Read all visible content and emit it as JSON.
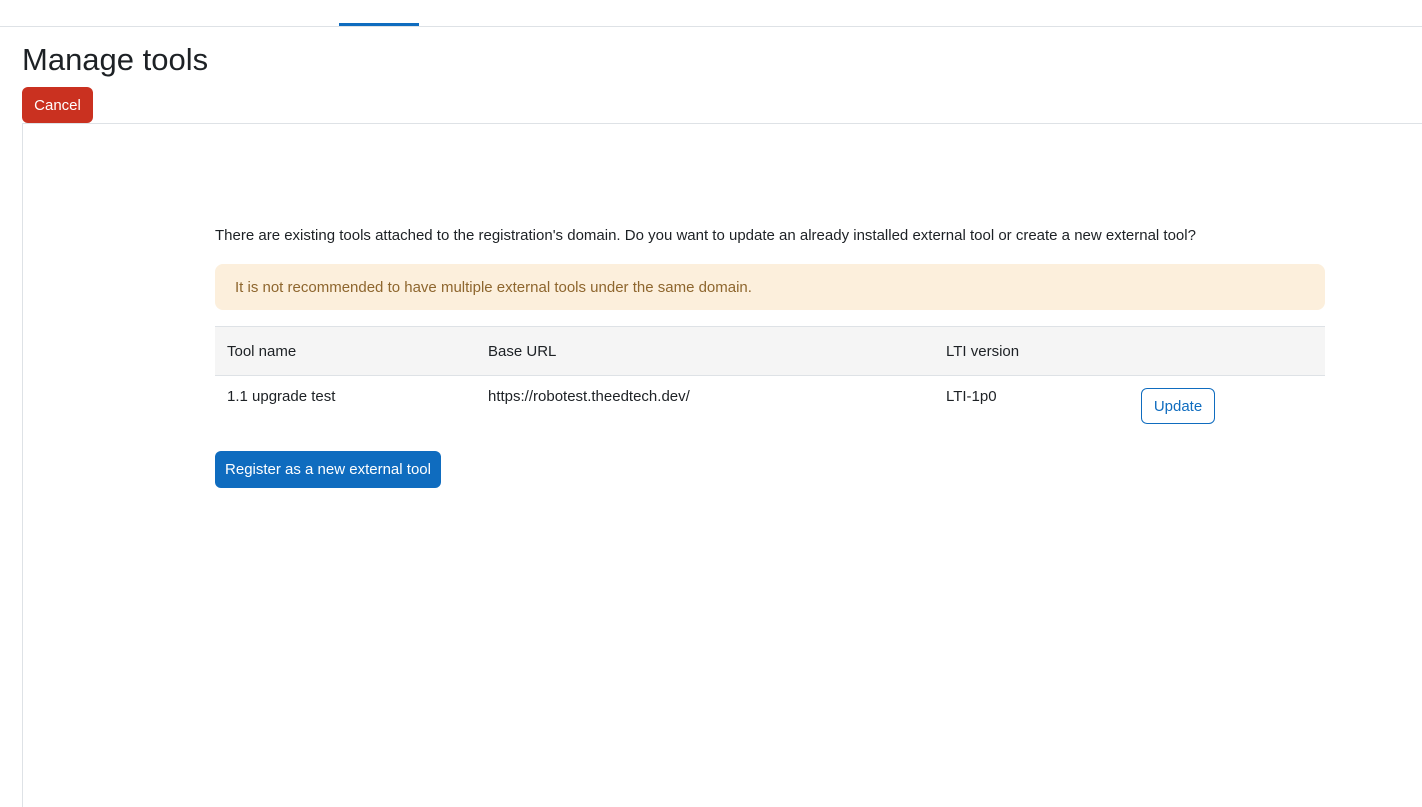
{
  "page": {
    "title": "Manage tools"
  },
  "actions": {
    "cancel_label": "Cancel",
    "register_label": "Register as a new external tool"
  },
  "message": {
    "intro": "There are existing tools attached to the registration's domain. Do you want to update an already installed external tool or create a new external tool?",
    "warning": "It is not recommended to have multiple external tools under the same domain."
  },
  "table": {
    "headers": [
      "Tool name",
      "Base URL",
      "LTI version",
      ""
    ],
    "rows": [
      {
        "tool_name": "1.1 upgrade test",
        "base_url": "https://robotest.theedtech.dev/",
        "lti_version": "LTI-1p0",
        "action_label": "Update"
      }
    ]
  },
  "colors": {
    "primary": "#0f6cbf",
    "danger": "#ca3120",
    "warning_bg": "#fcefdc",
    "warning_text": "#8e662e"
  }
}
